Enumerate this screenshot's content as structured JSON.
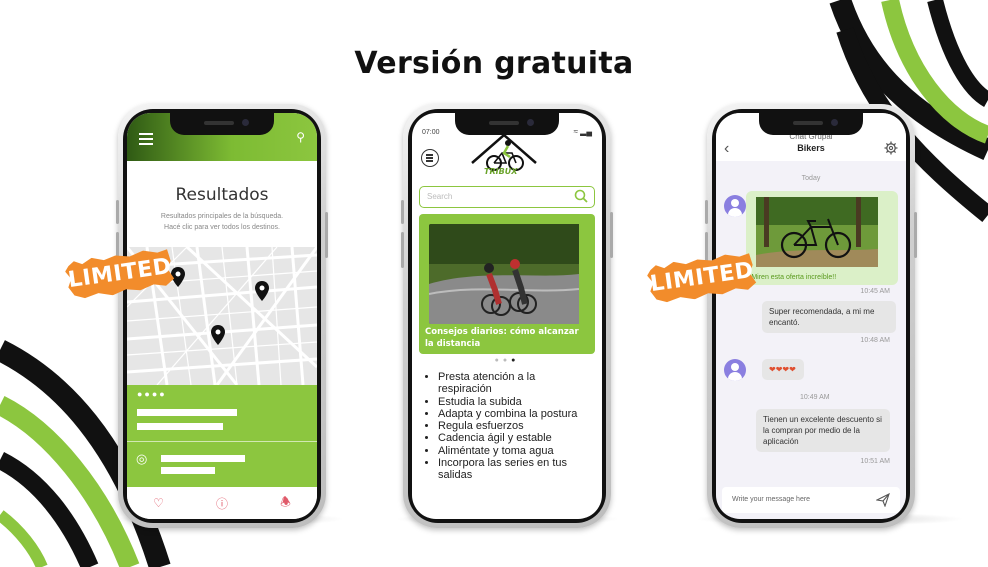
{
  "page": {
    "title": "Versión gratuita",
    "badge_text": "LIMITED"
  },
  "colors": {
    "accent_green": "#8cc63f",
    "stripe_black": "#111111",
    "badge_orange": "#f28c2b",
    "chat_avatar": "#8a7fe0",
    "nav_icon_red": "#e05a6a"
  },
  "phone1": {
    "heading": "Resultados",
    "subtitle_line1": "Resultados principales de la búsqueda.",
    "subtitle_line2": "Hacé clic para ver todos los destinos.",
    "icons": {
      "menu": "hamburger-icon",
      "search": "search-icon",
      "location": "location-pin-icon",
      "nav": [
        "heart-icon",
        "alert-icon",
        "bell-icon"
      ]
    }
  },
  "phone2": {
    "time": "07:00",
    "logo_text": "TRIBUX",
    "search_placeholder": "Search",
    "card_title": "Consejos diarios: cómo alcanzar la distancia",
    "tips": [
      "Presta atención a la respiración",
      "Estudia la subida",
      "Adapta y combina la postura",
      "Regula esfuerzos",
      "Cadencia ágil y estable",
      "Aliméntate y toma agua",
      "Incorpora las series en tus salidas"
    ]
  },
  "phone3": {
    "group_label": "Chat Grupal",
    "group_name": "Bikers",
    "day_label": "Today",
    "image_caption": "¡Miren esta oferta increíble!!",
    "messages": [
      {
        "text": "Super recomendada, a mi me encantó.",
        "time": "10:48 AM"
      },
      {
        "text": "❤❤❤❤",
        "time": "10:49 AM"
      },
      {
        "text": "Tienen un excelente descuento si la compran por medio de la aplicación",
        "time": "10:51 AM"
      }
    ],
    "image_time": "10:45 AM",
    "compose_placeholder": "Write your message here"
  }
}
